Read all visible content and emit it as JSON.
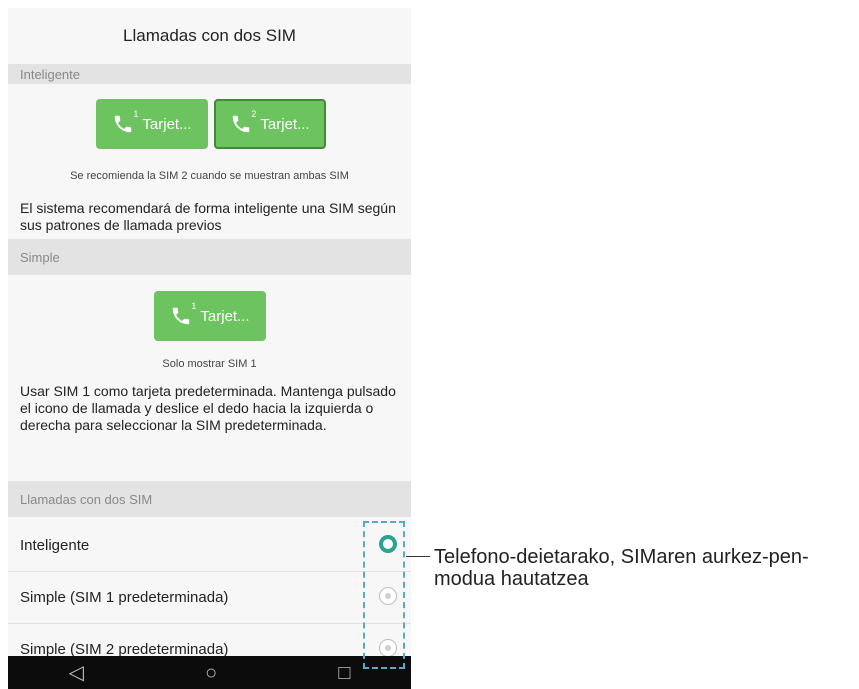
{
  "screen": {
    "title": "Llamadas con dos SIM"
  },
  "smart_section": {
    "header": "Inteligente",
    "buttons": [
      {
        "label": "Tarjet...",
        "sim": "1"
      },
      {
        "label": "Tarjet...",
        "sim": "2"
      }
    ],
    "caption": "Se recomienda la SIM 2 cuando se muestran ambas SIM",
    "description": "El sistema recomendará de forma inteligente una SIM según sus patrones de llamada previos"
  },
  "simple_section": {
    "header": "Simple",
    "button": {
      "label": "Tarjet...",
      "sim": "1"
    },
    "caption": "Solo mostrar SIM 1",
    "description": "Usar SIM 1 como tarjeta predeterminada. Mantenga pulsado el icono de llamada y deslice el dedo hacia la izquierda o derecha para seleccionar la SIM predeterminada."
  },
  "mode_section": {
    "header": "Llamadas con dos SIM",
    "options": [
      {
        "label": "Inteligente",
        "selected": true
      },
      {
        "label": "Simple (SIM 1 predeterminada)",
        "selected": false
      },
      {
        "label": "Simple (SIM 2 predeterminada)",
        "selected": false
      }
    ]
  },
  "navbar": {
    "back": "◁",
    "home": "○",
    "recents": "□"
  },
  "callout": {
    "text": "Telefono-deietarako, SIMaren aurkez-pen-modua hautatzea"
  },
  "colors": {
    "accent_green": "#6cc35f",
    "radio_teal": "#2aa48f",
    "highlight_blue": "#5aa9c7"
  }
}
